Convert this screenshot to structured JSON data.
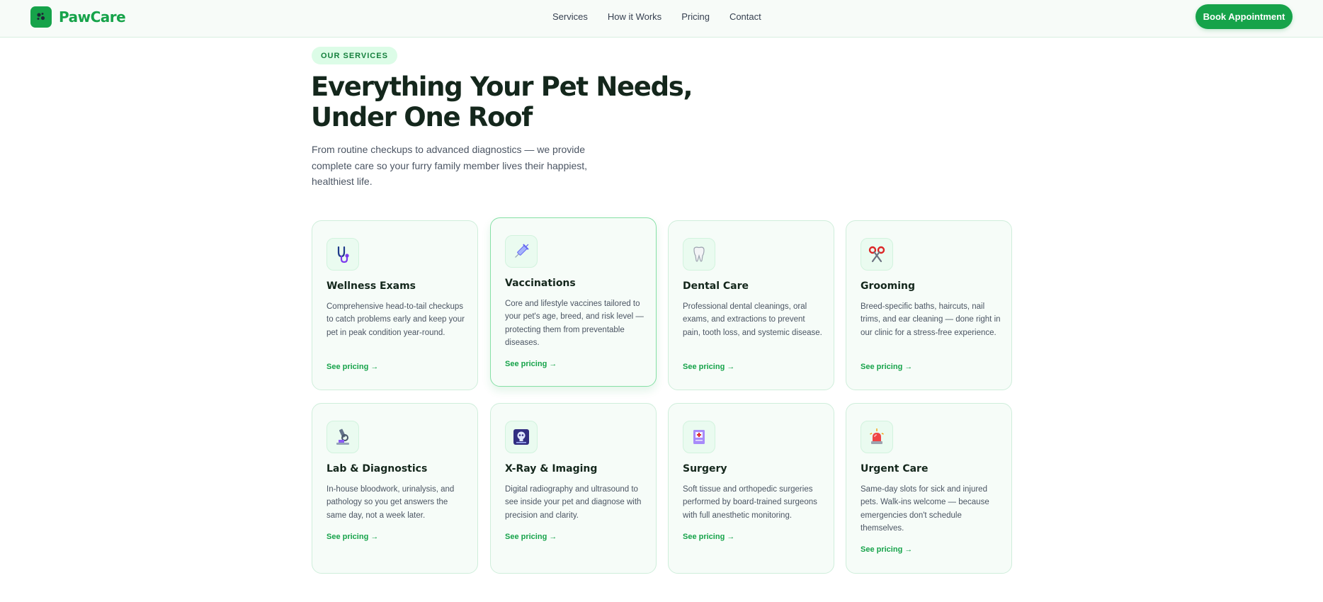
{
  "brand": {
    "name": "PawCare",
    "logo_icon": "paw-icon",
    "accent_color": "#16a34a"
  },
  "nav": {
    "links": [
      "Services",
      "How it Works",
      "Pricing",
      "Contact"
    ],
    "cta_label": "Book Appointment"
  },
  "hero": {
    "eyebrow": "OUR SERVICES",
    "headline_line1": "Everything Your Pet Needs,",
    "headline_line2": "Under One Roof",
    "subtext": "From routine checkups to advanced diagnostics — we provide complete care so your furry family member lives their happiest, healthiest life."
  },
  "services": [
    {
      "icon": "stethoscope-icon",
      "title": "Wellness Exams",
      "description": "Comprehensive head-to-tail checkups to catch problems early and keep your pet in peak condition year-round.",
      "link_label": "See pricing →"
    },
    {
      "icon": "syringe-icon",
      "title": "Vaccinations",
      "description": "Core and lifestyle vaccines tailored to your pet's age, breed, and risk level — protecting them from preventable diseases.",
      "link_label": "See pricing →"
    },
    {
      "icon": "tooth-icon",
      "title": "Dental Care",
      "description": "Professional dental cleanings, oral exams, and extractions to prevent pain, tooth loss, and systemic disease.",
      "link_label": "See pricing →"
    },
    {
      "icon": "scissors-icon",
      "title": "Grooming",
      "description": "Breed-specific baths, haircuts, nail trims, and ear cleaning — done right in our clinic for a stress-free experience.",
      "link_label": "See pricing →"
    },
    {
      "icon": "microscope-icon",
      "title": "Lab & Diagnostics",
      "description": "In-house bloodwork, urinalysis, and pathology so you get answers the same day, not a week later.",
      "link_label": "See pricing →"
    },
    {
      "icon": "xray-icon",
      "title": "X-Ray & Imaging",
      "description": "Digital radiography and ultrasound to see inside your pet and diagnose with precision and clarity.",
      "link_label": "See pricing →"
    },
    {
      "icon": "medical-book-icon",
      "title": "Surgery",
      "description": "Soft tissue and orthopedic surgeries performed by board-trained surgeons with full anesthetic monitoring.",
      "link_label": "See pricing →"
    },
    {
      "icon": "siren-icon",
      "title": "Urgent Care",
      "description": "Same-day slots for sick and injured pets. Walk-ins welcome — because emergencies don't schedule themselves.",
      "link_label": "See pricing →"
    }
  ]
}
